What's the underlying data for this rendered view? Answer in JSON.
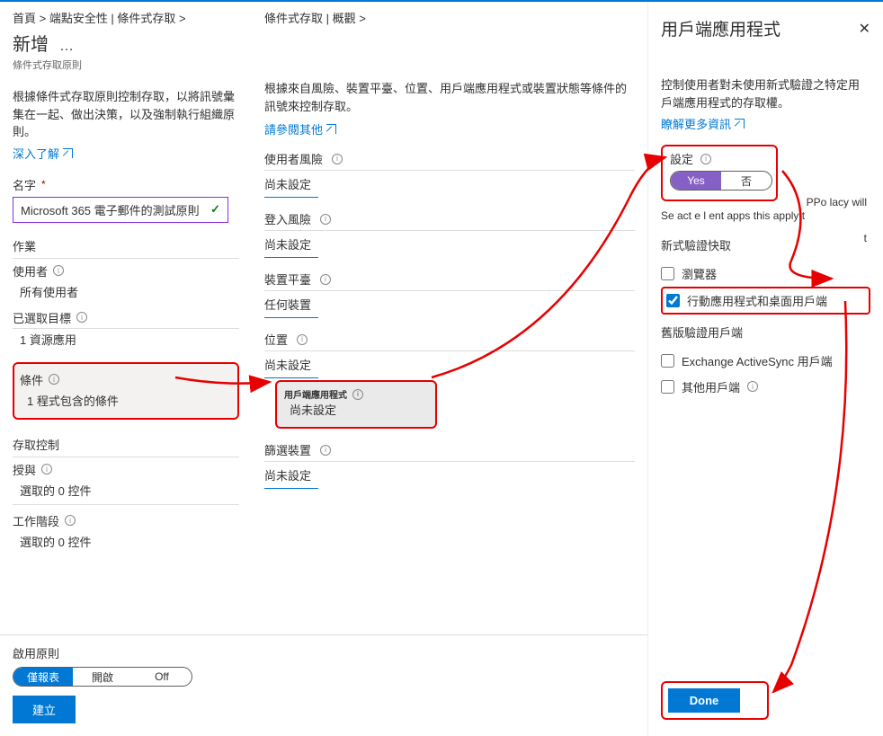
{
  "breadcrumb": {
    "left": "首頁 &gt; 端點安全性 | 條件式存取 &gt;",
    "mid": "條件式存取 | 概觀 &gt;"
  },
  "left": {
    "title": "新增",
    "dots": "…",
    "subtitle": "條件式存取原則",
    "desc": "根據條件式存取原則控制存取，以將訊號彙集在一起、做出決策，以及強制執行組織原則。",
    "learn_more": "深入了解",
    "name_label": "名字",
    "name_value": "Microsoft 365 電子郵件的測試原則",
    "work": "作業",
    "users_label": "使用者",
    "users_value": "所有使用者",
    "targets_label": "已選取目標",
    "targets_value": "1 資源應用",
    "conditions_label": "條件",
    "conditions_value": "1 程式包含的條件",
    "access_head": "存取控制",
    "grant_label": "授與",
    "grant_value": "選取的 0 控件",
    "session_label": "工作階段",
    "session_value": "選取的 0 控件"
  },
  "mid": {
    "desc": "根據來自風險、裝置平臺、位置、用戶端應用程式或裝置狀態等條件的訊號來控制存取。",
    "learn_more": "請參閱其他",
    "user_risk": "使用者風險",
    "signin_risk": "登入風險",
    "platform": "裝置平臺",
    "platform_val": "任何裝置",
    "location": "位置",
    "client_app": "用戶端應用程式",
    "filter_device": "篩選裝置",
    "not_set": "尚未設定"
  },
  "right": {
    "title": "用戶端應用程式",
    "desc": "控制使用者對未使用新式驗證之特定用戶端應用程式的存取權。",
    "learn_more": "瞭解更多資訊",
    "configure": "設定",
    "yes": "Yes",
    "no": "否",
    "note1": "Se act e l ent apps this apply t",
    "note2": "PPo lacy will",
    "note3": "t",
    "modern_head": "新式驗證快取",
    "cb_browser": "瀏覽器",
    "cb_mobile": "行動應用程式和桌面用戶端",
    "legacy_head": "舊版驗證用戶端",
    "cb_eas": "Exchange ActiveSync 用戶端",
    "cb_other": "其他用戶端",
    "done": "Done"
  },
  "footer": {
    "enable_label": "啟用原則",
    "report": "僅報表",
    "on": "開啟",
    "off": "Off",
    "create": "建立"
  }
}
